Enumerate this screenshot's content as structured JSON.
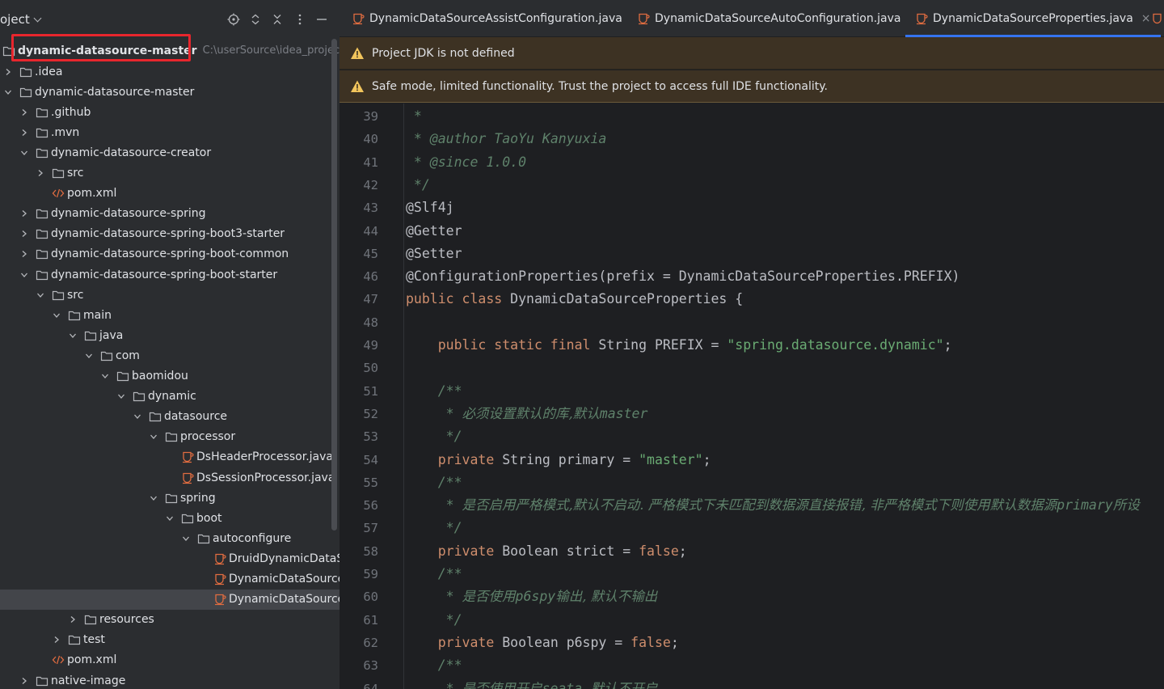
{
  "project_panel": {
    "title": "oject",
    "header_buttons": [
      "locate-icon",
      "expand-collapse-icon",
      "close-icon",
      "more-icon",
      "minimize-icon"
    ],
    "root": {
      "label": "dynamic-datasource-master",
      "path": "C:\\userSource\\idea_project\\d"
    },
    "tree": [
      {
        "label": ".idea",
        "icon": "folder",
        "depth": 0,
        "arrow": "right"
      },
      {
        "label": "dynamic-datasource-master",
        "icon": "folder",
        "depth": 0,
        "arrow": "down"
      },
      {
        "label": ".github",
        "icon": "folder",
        "depth": 1,
        "arrow": "right"
      },
      {
        "label": ".mvn",
        "icon": "folder",
        "depth": 1,
        "arrow": "right"
      },
      {
        "label": "dynamic-datasource-creator",
        "icon": "folder",
        "depth": 1,
        "arrow": "down"
      },
      {
        "label": "src",
        "icon": "folder",
        "depth": 2,
        "arrow": "right"
      },
      {
        "label": "pom.xml",
        "icon": "xml",
        "depth": 2,
        "arrow": "none"
      },
      {
        "label": "dynamic-datasource-spring",
        "icon": "folder",
        "depth": 1,
        "arrow": "right"
      },
      {
        "label": "dynamic-datasource-spring-boot3-starter",
        "icon": "folder",
        "depth": 1,
        "arrow": "right"
      },
      {
        "label": "dynamic-datasource-spring-boot-common",
        "icon": "folder",
        "depth": 1,
        "arrow": "right"
      },
      {
        "label": "dynamic-datasource-spring-boot-starter",
        "icon": "folder",
        "depth": 1,
        "arrow": "down"
      },
      {
        "label": "src",
        "icon": "folder",
        "depth": 2,
        "arrow": "down"
      },
      {
        "label": "main",
        "icon": "folder",
        "depth": 3,
        "arrow": "down"
      },
      {
        "label": "java",
        "icon": "folder",
        "depth": 4,
        "arrow": "down"
      },
      {
        "label": "com",
        "icon": "folder",
        "depth": 5,
        "arrow": "down"
      },
      {
        "label": "baomidou",
        "icon": "folder",
        "depth": 6,
        "arrow": "down"
      },
      {
        "label": "dynamic",
        "icon": "folder",
        "depth": 7,
        "arrow": "down"
      },
      {
        "label": "datasource",
        "icon": "folder",
        "depth": 8,
        "arrow": "down"
      },
      {
        "label": "processor",
        "icon": "folder",
        "depth": 9,
        "arrow": "down"
      },
      {
        "label": "DsHeaderProcessor.java",
        "icon": "java",
        "depth": 10,
        "arrow": "none"
      },
      {
        "label": "DsSessionProcessor.java",
        "icon": "java",
        "depth": 10,
        "arrow": "none"
      },
      {
        "label": "spring",
        "icon": "folder",
        "depth": 9,
        "arrow": "down"
      },
      {
        "label": "boot",
        "icon": "folder",
        "depth": 10,
        "arrow": "down"
      },
      {
        "label": "autoconfigure",
        "icon": "folder",
        "depth": 11,
        "arrow": "down"
      },
      {
        "label": "DruidDynamicDataSo",
        "icon": "java",
        "depth": 12,
        "arrow": "none"
      },
      {
        "label": "DynamicDataSourceA",
        "icon": "java",
        "depth": 12,
        "arrow": "none"
      },
      {
        "label": "DynamicDataSourceA",
        "icon": "java",
        "depth": 12,
        "arrow": "none",
        "selected": true
      },
      {
        "label": "resources",
        "icon": "folder",
        "depth": 4,
        "arrow": "right"
      },
      {
        "label": "test",
        "icon": "folder",
        "depth": 3,
        "arrow": "right"
      },
      {
        "label": "pom.xml",
        "icon": "xml",
        "depth": 2,
        "arrow": "none"
      },
      {
        "label": "native-image",
        "icon": "folder",
        "depth": 1,
        "arrow": "right"
      }
    ]
  },
  "editor": {
    "tabs": [
      {
        "label": "DynamicDataSourceAssistConfiguration.java",
        "active": false
      },
      {
        "label": "DynamicDataSourceAutoConfiguration.java",
        "active": false
      },
      {
        "label": "DynamicDataSourceProperties.java",
        "active": true,
        "close": "×"
      }
    ],
    "banners": {
      "jdk": "Project JDK is not defined",
      "safe_mode": "Safe mode, limited functionality. Trust the project to access full IDE functionality."
    },
    "lines": [
      {
        "num": "39",
        "tokens": [
          {
            "t": " *",
            "c": "doc"
          }
        ]
      },
      {
        "num": "40",
        "tokens": [
          {
            "t": " * ",
            "c": "doc"
          },
          {
            "t": "@author",
            "c": "doc"
          },
          {
            "t": " TaoYu Kanyuxia",
            "c": "doc"
          }
        ]
      },
      {
        "num": "41",
        "tokens": [
          {
            "t": " * ",
            "c": "doc"
          },
          {
            "t": "@since",
            "c": "doc"
          },
          {
            "t": " 1.0.0",
            "c": "doc"
          }
        ]
      },
      {
        "num": "42",
        "tokens": [
          {
            "t": " */",
            "c": "doc"
          }
        ]
      },
      {
        "num": "43",
        "tokens": [
          {
            "t": "@Slf4j",
            "c": "plain"
          }
        ]
      },
      {
        "num": "44",
        "tokens": [
          {
            "t": "@Getter",
            "c": "plain"
          }
        ]
      },
      {
        "num": "45",
        "tokens": [
          {
            "t": "@Setter",
            "c": "plain"
          }
        ]
      },
      {
        "num": "46",
        "tokens": [
          {
            "t": "@ConfigurationProperties(prefix = DynamicDataSourceProperties.PREFIX)",
            "c": "plain"
          }
        ]
      },
      {
        "num": "47",
        "tokens": [
          {
            "t": "public class ",
            "c": "kw"
          },
          {
            "t": "DynamicDataSourceProperties {",
            "c": "plain"
          }
        ]
      },
      {
        "num": "48",
        "tokens": []
      },
      {
        "num": "49",
        "tokens": [
          {
            "t": "    public static final ",
            "c": "kw"
          },
          {
            "t": "String PREFIX = ",
            "c": "plain"
          },
          {
            "t": "\"spring.datasource.dynamic\"",
            "c": "str"
          },
          {
            "t": ";",
            "c": "plain"
          }
        ]
      },
      {
        "num": "50",
        "tokens": []
      },
      {
        "num": "51",
        "tokens": [
          {
            "t": "    /**",
            "c": "doc"
          }
        ]
      },
      {
        "num": "52",
        "tokens": [
          {
            "t": "     * ",
            "c": "doc"
          },
          {
            "t": "必须设置默认的库,默认",
            "c": "doc cjk"
          },
          {
            "t": "master",
            "c": "doc"
          }
        ]
      },
      {
        "num": "53",
        "tokens": [
          {
            "t": "     */",
            "c": "doc"
          }
        ]
      },
      {
        "num": "54",
        "tokens": [
          {
            "t": "    private ",
            "c": "kw"
          },
          {
            "t": "String primary = ",
            "c": "plain"
          },
          {
            "t": "\"master\"",
            "c": "str"
          },
          {
            "t": ";",
            "c": "plain"
          }
        ]
      },
      {
        "num": "55",
        "tokens": [
          {
            "t": "    /**",
            "c": "doc"
          }
        ]
      },
      {
        "num": "56",
        "tokens": [
          {
            "t": "     * ",
            "c": "doc"
          },
          {
            "t": "是否启用严格模式,默认不启动. 严格模式下未匹配到数据源直接报错, 非严格模式下则使用默认数据源",
            "c": "doc cjk"
          },
          {
            "t": "primary",
            "c": "doc"
          },
          {
            "t": "所设",
            "c": "doc cjk"
          }
        ]
      },
      {
        "num": "57",
        "tokens": [
          {
            "t": "     */",
            "c": "doc"
          }
        ]
      },
      {
        "num": "58",
        "tokens": [
          {
            "t": "    private ",
            "c": "kw"
          },
          {
            "t": "Boolean strict = ",
            "c": "plain"
          },
          {
            "t": "false",
            "c": "kw"
          },
          {
            "t": ";",
            "c": "plain"
          }
        ]
      },
      {
        "num": "59",
        "tokens": [
          {
            "t": "    /**",
            "c": "doc"
          }
        ]
      },
      {
        "num": "60",
        "tokens": [
          {
            "t": "     * ",
            "c": "doc"
          },
          {
            "t": "是否使用",
            "c": "doc cjk"
          },
          {
            "t": "p6spy",
            "c": "doc"
          },
          {
            "t": "输出, 默认不输出",
            "c": "doc cjk"
          }
        ]
      },
      {
        "num": "61",
        "tokens": [
          {
            "t": "     */",
            "c": "doc"
          }
        ]
      },
      {
        "num": "62",
        "tokens": [
          {
            "t": "    private ",
            "c": "kw"
          },
          {
            "t": "Boolean p6spy = ",
            "c": "plain"
          },
          {
            "t": "false",
            "c": "kw"
          },
          {
            "t": ";",
            "c": "plain"
          }
        ]
      },
      {
        "num": "63",
        "tokens": [
          {
            "t": "    /**",
            "c": "doc"
          }
        ]
      },
      {
        "num": "64",
        "tokens": [
          {
            "t": "     * ",
            "c": "doc"
          },
          {
            "t": "是否使用开启",
            "c": "doc cjk"
          },
          {
            "t": "seata",
            "c": "doc"
          },
          {
            "t": ", 默认不开启",
            "c": "doc cjk"
          }
        ]
      }
    ]
  },
  "colors": {
    "panel_bg": "#2b2d30",
    "editor_bg": "#1e1f22",
    "banner_bg": "#3d3223",
    "keyword": "#cf8e6d",
    "string": "#6aab73",
    "doc_comment": "#5f826b",
    "highlight_box": "#e8262d",
    "active_tab_underline": "#3574f0"
  }
}
